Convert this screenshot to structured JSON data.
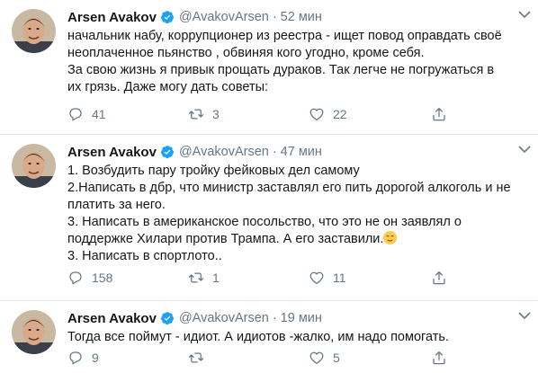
{
  "colors": {
    "text": "#14171a",
    "secondary": "#657786",
    "verified": "#1da1f2",
    "divider": "#e6ecf0"
  },
  "tweets": [
    {
      "name": "Arsen Avakov",
      "handle": "@AvakovArsen",
      "separator": "·",
      "time": "52 мин",
      "lines": [
        "начальник набу, коррупционер из реестра - ищет повод оправдать своё",
        "неоплаченное пьянство , обвиняя кого угодно, кроме себя.",
        "За свою жизнь я привык прощать дураков. Так легче не погружаться в",
        "их грязь. Даже могу дать советы:"
      ],
      "replies": "41",
      "retweets": "3",
      "likes": "22"
    },
    {
      "name": "Arsen Avakov",
      "handle": "@AvakovArsen",
      "separator": "·",
      "time": "47 мин",
      "lines": [
        "1. Возбудить пару тройку фейковых дел  самому",
        "2.Написать в дбр, что министр заставлял его пить дорогой алкоголь и не",
        "платить за него.",
        "3. Написать в американское посольство, что это не он заявлял о",
        "поддержке Хилари против Трампа.  А его заставили.",
        "3. Написать в спортлото.."
      ],
      "emoji": "relieved-face",
      "replies": "158",
      "retweets": "1",
      "likes": "11"
    },
    {
      "name": "Arsen Avakov",
      "handle": "@AvakovArsen",
      "separator": "·",
      "time": "19 мин",
      "lines": [
        "Тогда все поймут - идиот. А идиотов -жалко, им надо помогать."
      ],
      "replies": "9",
      "retweets": "",
      "likes": "5"
    }
  ]
}
